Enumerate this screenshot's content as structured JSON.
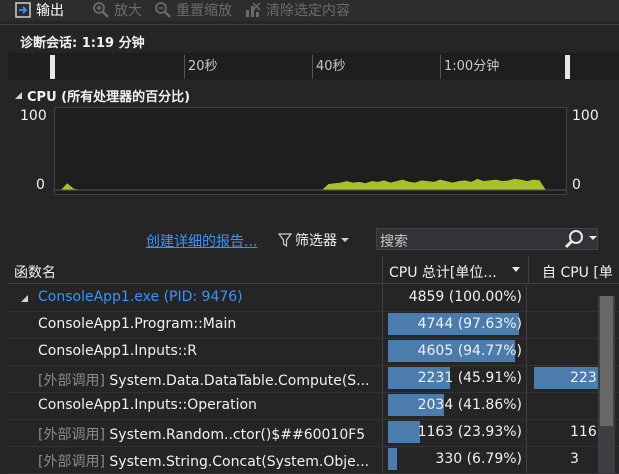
{
  "toolbar": {
    "output": "输出",
    "zoom_in": "放大",
    "reset_zoom": "重置缩放",
    "clear_selection": "清除选定内容"
  },
  "session": {
    "label": "诊断会话: 1:19 分钟"
  },
  "ruler": {
    "ticks": [
      "20秒",
      "40秒",
      "1:00分钟"
    ]
  },
  "cpu": {
    "title": "CPU (所有处理器的百分比)",
    "y_max": "100",
    "y_min": "0",
    "series_color": "#a6c12a"
  },
  "chart_data": {
    "type": "area",
    "title": "CPU (所有处理器的百分比)",
    "xlabel": "",
    "ylabel": "",
    "ylim": [
      0,
      100
    ],
    "x": [
      0,
      1,
      2,
      3,
      4,
      5,
      6,
      7,
      8,
      9,
      10,
      11,
      12,
      13,
      14,
      15,
      16,
      17,
      18,
      19,
      20,
      21,
      22,
      23,
      24,
      25,
      26,
      27,
      28,
      29,
      30,
      31,
      32,
      33,
      34,
      35,
      36,
      37,
      38,
      39,
      40,
      41,
      42,
      43,
      44,
      45,
      46,
      47,
      48,
      49,
      50,
      51,
      52,
      53,
      54,
      55,
      56,
      57,
      58,
      59,
      60,
      61,
      62,
      63,
      64,
      65,
      66,
      67,
      68,
      69,
      70,
      71,
      72,
      73,
      74,
      75,
      76,
      77,
      78,
      79
    ],
    "series": [
      {
        "values": [
          0,
          9,
          2,
          0,
          0,
          0,
          0,
          0,
          0,
          0,
          0,
          0,
          0,
          0,
          0,
          0,
          0,
          0,
          0,
          0,
          0,
          0,
          0,
          0,
          0,
          0,
          0,
          0,
          0,
          0,
          0,
          0,
          0,
          0,
          0,
          0,
          0,
          0,
          0,
          0,
          0,
          0,
          0,
          8,
          9,
          10,
          12,
          10,
          11,
          9,
          12,
          11,
          13,
          10,
          12,
          14,
          11,
          10,
          13,
          12,
          11,
          14,
          12,
          10,
          12,
          13,
          11,
          15,
          12,
          13,
          14,
          12,
          13,
          15,
          14,
          12,
          14,
          13,
          0,
          0
        ]
      }
    ],
    "grid": false
  },
  "filter": {
    "report_link": "创建详细的报告...",
    "filter_label": "筛选器",
    "search_placeholder": "搜索"
  },
  "grid": {
    "columns": [
      "函数名",
      "CPU 总计[单位...",
      "自 CPU [单"
    ],
    "rows": [
      {
        "name": "ConsoleApp1.exe (PID: 9476)",
        "total": "4859 (100.00%)",
        "total_pct": 100,
        "self": "",
        "self_pct": 0
      },
      {
        "name": "ConsoleApp1.Program::Main",
        "total": "4744 (97.63%)",
        "total_pct": 97.63,
        "self": "",
        "self_pct": 0
      },
      {
        "name": "ConsoleApp1.Inputs::R",
        "total": "4605 (94.77%)",
        "total_pct": 94.77,
        "self": "",
        "self_pct": 0
      },
      {
        "prefix": "[外部调用]",
        "name": "System.Data.DataTable.Compute(S...",
        "total": "2231 (45.91%)",
        "total_pct": 45.91,
        "self": "223",
        "self_pct": 45.91
      },
      {
        "name": "ConsoleApp1.Inputs::Operation",
        "total": "2034 (41.86%)",
        "total_pct": 41.86,
        "self": "",
        "self_pct": 0
      },
      {
        "prefix": "[外部调用]",
        "name": "System.Random..ctor()$##60010F5",
        "total": "1163 (23.93%)",
        "total_pct": 23.93,
        "self": "116",
        "self_pct": 0
      },
      {
        "prefix": "[外部调用]",
        "name": "System.String.Concat(System.Obje...",
        "total": "330 (6.79%)",
        "total_pct": 6.79,
        "self": "3",
        "self_pct": 0
      }
    ]
  },
  "colors": {
    "accent": "#3794ff",
    "bar": "#4a7cad",
    "cpu_line": "#a6c12a"
  }
}
